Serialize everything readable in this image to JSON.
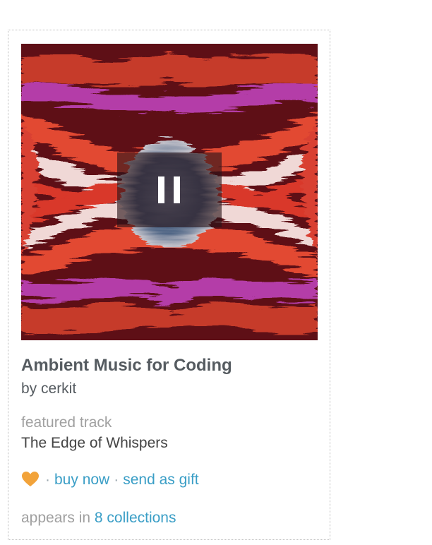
{
  "album": {
    "title": "Ambient Music for Coding",
    "artist_line": "by cerkit",
    "artwork_icon": "album-artwork",
    "player_state_icon": "pause-icon"
  },
  "featured": {
    "label": "featured track",
    "track": "The Edge of Whispers"
  },
  "actions": {
    "wishlist_icon": "heart-icon",
    "separator": "·",
    "buy_label": "buy now",
    "gift_label": "send as gift"
  },
  "collections": {
    "prefix": "appears in",
    "link_label": "8 collections"
  },
  "colors": {
    "link": "#3a9ec6",
    "heart": "#f2a33a",
    "title": "#555b60",
    "muted": "#a0a0a0"
  }
}
